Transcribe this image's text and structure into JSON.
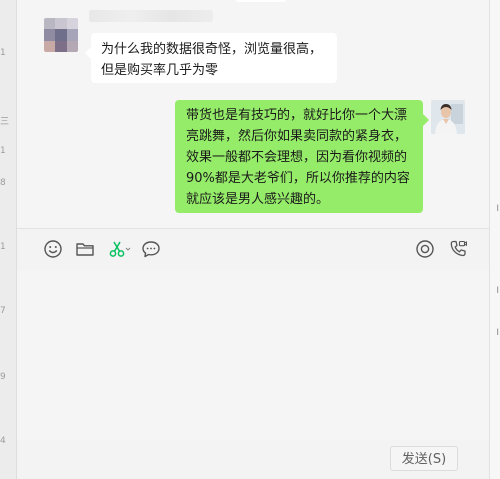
{
  "chat": {
    "incoming": {
      "text": "为什么我的数据很奇怪，浏览量很高，但是购买率几乎为零"
    },
    "outgoing": {
      "text": "带货也是有技巧的，就好比你一个大漂亮跳舞，然后你如果卖同款的紧身衣，效果一般都不会理想，因为看你视频的90%都是大老爷们，所以你推荐的内容就应该是男人感兴趣的。"
    }
  },
  "toolbar": {
    "left_tools": [
      "emoji-icon",
      "folder-icon",
      "scissors-icon",
      "chat-bubble-icon"
    ],
    "right_tools": [
      "live-icon",
      "video-call-icon"
    ]
  },
  "input": {
    "send_label": "发送(S)"
  },
  "colors": {
    "outgoing_bubble": "#95ec69",
    "incoming_bubble": "#ffffff",
    "scissors_accent": "#07c160"
  }
}
